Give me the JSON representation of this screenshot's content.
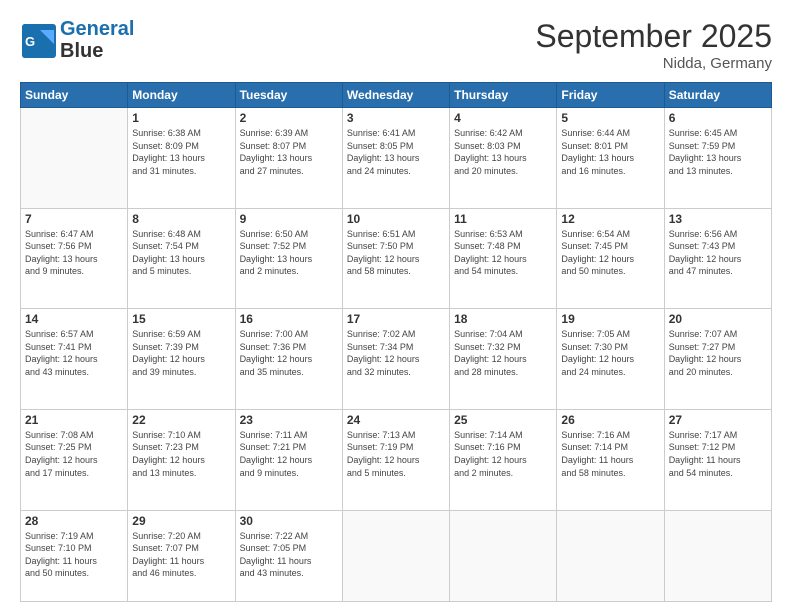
{
  "header": {
    "logo_line1": "General",
    "logo_line2": "Blue",
    "month": "September 2025",
    "location": "Nidda, Germany"
  },
  "weekdays": [
    "Sunday",
    "Monday",
    "Tuesday",
    "Wednesday",
    "Thursday",
    "Friday",
    "Saturday"
  ],
  "weeks": [
    [
      {
        "day": "",
        "info": ""
      },
      {
        "day": "1",
        "info": "Sunrise: 6:38 AM\nSunset: 8:09 PM\nDaylight: 13 hours\nand 31 minutes."
      },
      {
        "day": "2",
        "info": "Sunrise: 6:39 AM\nSunset: 8:07 PM\nDaylight: 13 hours\nand 27 minutes."
      },
      {
        "day": "3",
        "info": "Sunrise: 6:41 AM\nSunset: 8:05 PM\nDaylight: 13 hours\nand 24 minutes."
      },
      {
        "day": "4",
        "info": "Sunrise: 6:42 AM\nSunset: 8:03 PM\nDaylight: 13 hours\nand 20 minutes."
      },
      {
        "day": "5",
        "info": "Sunrise: 6:44 AM\nSunset: 8:01 PM\nDaylight: 13 hours\nand 16 minutes."
      },
      {
        "day": "6",
        "info": "Sunrise: 6:45 AM\nSunset: 7:59 PM\nDaylight: 13 hours\nand 13 minutes."
      }
    ],
    [
      {
        "day": "7",
        "info": "Sunrise: 6:47 AM\nSunset: 7:56 PM\nDaylight: 13 hours\nand 9 minutes."
      },
      {
        "day": "8",
        "info": "Sunrise: 6:48 AM\nSunset: 7:54 PM\nDaylight: 13 hours\nand 5 minutes."
      },
      {
        "day": "9",
        "info": "Sunrise: 6:50 AM\nSunset: 7:52 PM\nDaylight: 13 hours\nand 2 minutes."
      },
      {
        "day": "10",
        "info": "Sunrise: 6:51 AM\nSunset: 7:50 PM\nDaylight: 12 hours\nand 58 minutes."
      },
      {
        "day": "11",
        "info": "Sunrise: 6:53 AM\nSunset: 7:48 PM\nDaylight: 12 hours\nand 54 minutes."
      },
      {
        "day": "12",
        "info": "Sunrise: 6:54 AM\nSunset: 7:45 PM\nDaylight: 12 hours\nand 50 minutes."
      },
      {
        "day": "13",
        "info": "Sunrise: 6:56 AM\nSunset: 7:43 PM\nDaylight: 12 hours\nand 47 minutes."
      }
    ],
    [
      {
        "day": "14",
        "info": "Sunrise: 6:57 AM\nSunset: 7:41 PM\nDaylight: 12 hours\nand 43 minutes."
      },
      {
        "day": "15",
        "info": "Sunrise: 6:59 AM\nSunset: 7:39 PM\nDaylight: 12 hours\nand 39 minutes."
      },
      {
        "day": "16",
        "info": "Sunrise: 7:00 AM\nSunset: 7:36 PM\nDaylight: 12 hours\nand 35 minutes."
      },
      {
        "day": "17",
        "info": "Sunrise: 7:02 AM\nSunset: 7:34 PM\nDaylight: 12 hours\nand 32 minutes."
      },
      {
        "day": "18",
        "info": "Sunrise: 7:04 AM\nSunset: 7:32 PM\nDaylight: 12 hours\nand 28 minutes."
      },
      {
        "day": "19",
        "info": "Sunrise: 7:05 AM\nSunset: 7:30 PM\nDaylight: 12 hours\nand 24 minutes."
      },
      {
        "day": "20",
        "info": "Sunrise: 7:07 AM\nSunset: 7:27 PM\nDaylight: 12 hours\nand 20 minutes."
      }
    ],
    [
      {
        "day": "21",
        "info": "Sunrise: 7:08 AM\nSunset: 7:25 PM\nDaylight: 12 hours\nand 17 minutes."
      },
      {
        "day": "22",
        "info": "Sunrise: 7:10 AM\nSunset: 7:23 PM\nDaylight: 12 hours\nand 13 minutes."
      },
      {
        "day": "23",
        "info": "Sunrise: 7:11 AM\nSunset: 7:21 PM\nDaylight: 12 hours\nand 9 minutes."
      },
      {
        "day": "24",
        "info": "Sunrise: 7:13 AM\nSunset: 7:19 PM\nDaylight: 12 hours\nand 5 minutes."
      },
      {
        "day": "25",
        "info": "Sunrise: 7:14 AM\nSunset: 7:16 PM\nDaylight: 12 hours\nand 2 minutes."
      },
      {
        "day": "26",
        "info": "Sunrise: 7:16 AM\nSunset: 7:14 PM\nDaylight: 11 hours\nand 58 minutes."
      },
      {
        "day": "27",
        "info": "Sunrise: 7:17 AM\nSunset: 7:12 PM\nDaylight: 11 hours\nand 54 minutes."
      }
    ],
    [
      {
        "day": "28",
        "info": "Sunrise: 7:19 AM\nSunset: 7:10 PM\nDaylight: 11 hours\nand 50 minutes."
      },
      {
        "day": "29",
        "info": "Sunrise: 7:20 AM\nSunset: 7:07 PM\nDaylight: 11 hours\nand 46 minutes."
      },
      {
        "day": "30",
        "info": "Sunrise: 7:22 AM\nSunset: 7:05 PM\nDaylight: 11 hours\nand 43 minutes."
      },
      {
        "day": "",
        "info": ""
      },
      {
        "day": "",
        "info": ""
      },
      {
        "day": "",
        "info": ""
      },
      {
        "day": "",
        "info": ""
      }
    ]
  ]
}
